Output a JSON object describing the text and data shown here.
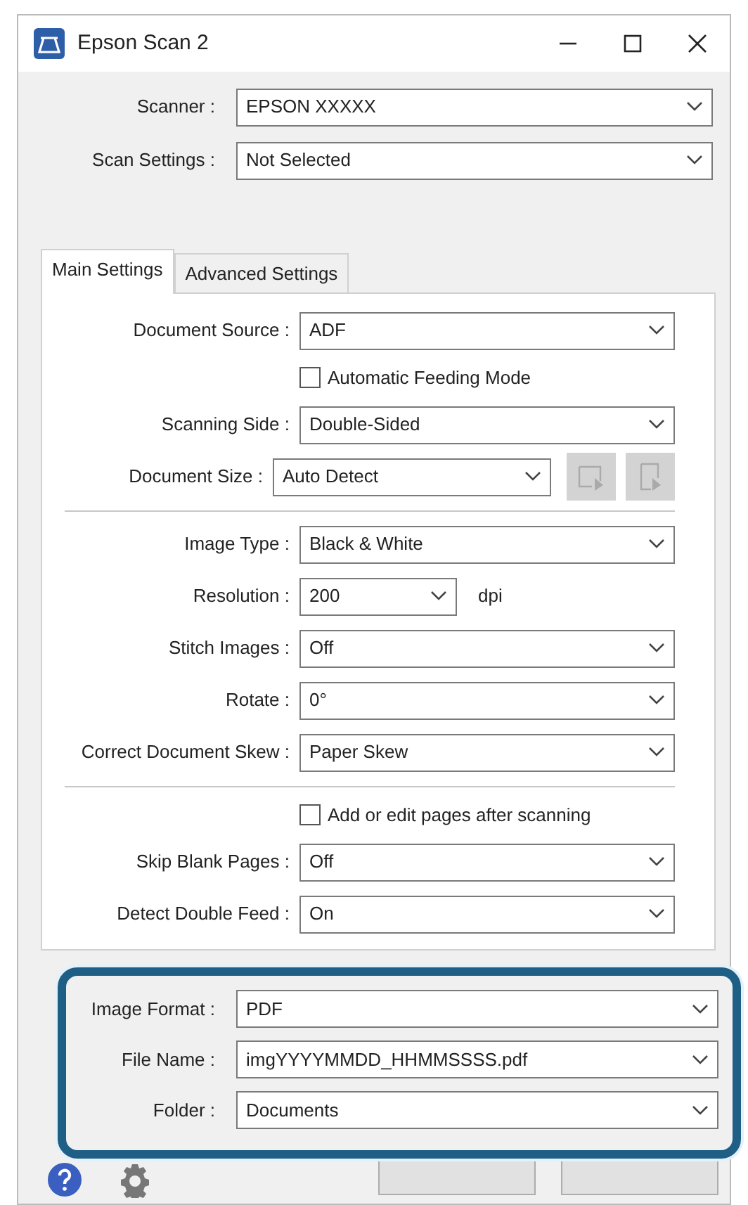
{
  "window": {
    "title": "Epson Scan 2"
  },
  "top_fields": [
    {
      "label": "Scanner :",
      "value": "EPSON XXXXX"
    },
    {
      "label": "Scan Settings :",
      "value": "Not Selected"
    }
  ],
  "tabs": [
    {
      "label": "Main Settings",
      "selected": true
    },
    {
      "label": "Advanced Settings",
      "selected": false
    }
  ],
  "main_settings": [
    [
      {
        "kind": "select",
        "label": "Document Source :",
        "value": "ADF"
      },
      {
        "kind": "checkbox",
        "label": "Automatic Feeding Mode",
        "checked": false
      },
      {
        "kind": "select",
        "label": "Scanning Side :",
        "value": "Double-Sided"
      },
      {
        "kind": "select_buttons",
        "label": "Document Size :",
        "value": "Auto Detect"
      }
    ],
    [
      {
        "kind": "select",
        "label": "Image Type :",
        "value": "Black & White"
      },
      {
        "kind": "select_unit",
        "label": "Resolution :",
        "value": "200",
        "unit": "dpi"
      },
      {
        "kind": "select",
        "label": "Stitch Images :",
        "value": "Off"
      },
      {
        "kind": "select",
        "label": "Rotate :",
        "value": "0°"
      },
      {
        "kind": "select",
        "label": "Correct Document Skew :",
        "value": "Paper Skew"
      }
    ],
    [
      {
        "kind": "checkbox",
        "label": "Add or edit pages after scanning",
        "checked": false
      },
      {
        "kind": "select",
        "label": "Skip Blank Pages :",
        "value": "Off"
      },
      {
        "kind": "select",
        "label": "Detect Double Feed :",
        "value": "On"
      }
    ]
  ],
  "highlighted_fields": [
    {
      "label": "Image Format :",
      "value": "PDF"
    },
    {
      "label": "File Name :",
      "value": "imgYYYYMMDD_HHMMSSSS.pdf"
    },
    {
      "label": "Folder :",
      "value": "Documents"
    }
  ]
}
